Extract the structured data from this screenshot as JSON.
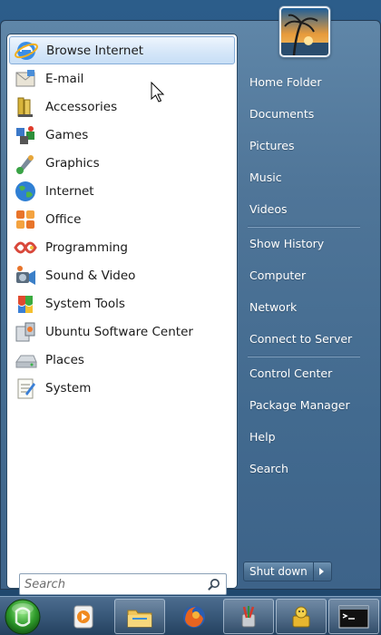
{
  "start_menu": {
    "programs": [
      {
        "label": "Browse Internet",
        "icon": "internet-explorer-icon",
        "selected": true
      },
      {
        "label": "E-mail",
        "icon": "email-icon"
      },
      {
        "label": "Accessories",
        "icon": "accessories-icon"
      },
      {
        "label": "Games",
        "icon": "games-icon"
      },
      {
        "label": "Graphics",
        "icon": "graphics-icon"
      },
      {
        "label": "Internet",
        "icon": "globe-icon"
      },
      {
        "label": "Office",
        "icon": "office-icon"
      },
      {
        "label": "Programming",
        "icon": "programming-icon"
      },
      {
        "label": "Sound & Video",
        "icon": "sound-video-icon"
      },
      {
        "label": "System Tools",
        "icon": "system-tools-icon"
      },
      {
        "label": "Ubuntu Software Center",
        "icon": "software-center-icon"
      },
      {
        "label": "Places",
        "icon": "drive-icon"
      },
      {
        "label": "System",
        "icon": "system-icon"
      }
    ],
    "search": {
      "placeholder": "Search",
      "value": ""
    },
    "places": {
      "group1": [
        "Home Folder",
        "Documents",
        "Pictures",
        "Music",
        "Videos"
      ],
      "group2": [
        "Show History",
        "Computer",
        "Network",
        "Connect to Server"
      ],
      "group3": [
        "Control Center",
        "Package Manager",
        "Help",
        "Search"
      ]
    },
    "shutdown_label": "Shut down",
    "user_picture": "beach-sunset-avatar"
  },
  "taskbar": {
    "items": [
      "start-orb",
      "media-player-icon",
      "file-manager-icon",
      "firefox-icon",
      "graphics-editor-icon",
      "package-installer-icon",
      "terminal-icon"
    ]
  },
  "colors": {
    "menu_blue": "#4f7598",
    "selection": "#c7def6",
    "taskbar": "#3a5a7b"
  }
}
